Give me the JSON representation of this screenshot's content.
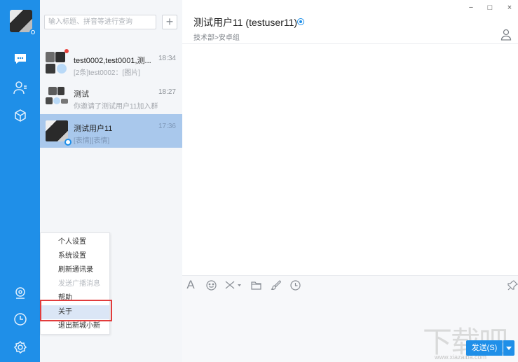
{
  "app": {
    "colors": {
      "accent": "#1f8fe8",
      "rail": "#1f8fe8",
      "selected_row": "#a9c8ec",
      "highlight_box": "#e23c3c"
    }
  },
  "rail": {
    "icons": [
      "chat-bubble-icon",
      "contacts-icon",
      "cube-icon",
      "location-icon",
      "clock-icon",
      "settings-gear-icon"
    ]
  },
  "search": {
    "placeholder": "输入标题、拼音等进行查询",
    "add_label": "+"
  },
  "conversations": [
    {
      "title": "test0002,test0001,测...",
      "time": "18:34",
      "preview": "[2条]test0002：[图片]"
    },
    {
      "title": "测试",
      "time": "18:27",
      "preview": "你邀请了测试用户11加入群"
    },
    {
      "title": "测试用户11",
      "time": "17:36",
      "preview": "[表情][表情]"
    }
  ],
  "chat": {
    "title": "测试用户11 (testuser11)",
    "subtitle": "技术部>安卓组",
    "window_controls": [
      "−",
      "□",
      "×"
    ],
    "toolbar_icons": [
      "font-icon",
      "emoji-icon",
      "scissors-icon",
      "folder-icon",
      "brush-icon",
      "history-clock-icon",
      "pin-icon"
    ],
    "send_label": "发送(S)"
  },
  "menu": {
    "items": [
      {
        "label": "个人设置",
        "disabled": false
      },
      {
        "label": "系统设置",
        "disabled": false
      },
      {
        "label": "刷新通讯录",
        "disabled": false
      },
      {
        "label": "发送广播消息",
        "disabled": true
      },
      {
        "label": "帮助",
        "disabled": false
      },
      {
        "label": "关于",
        "disabled": false
      },
      {
        "label": "退出新城小新",
        "disabled": false
      }
    ]
  },
  "watermark": {
    "text": "下载吧",
    "sub": "www.xiazaiba.com"
  }
}
